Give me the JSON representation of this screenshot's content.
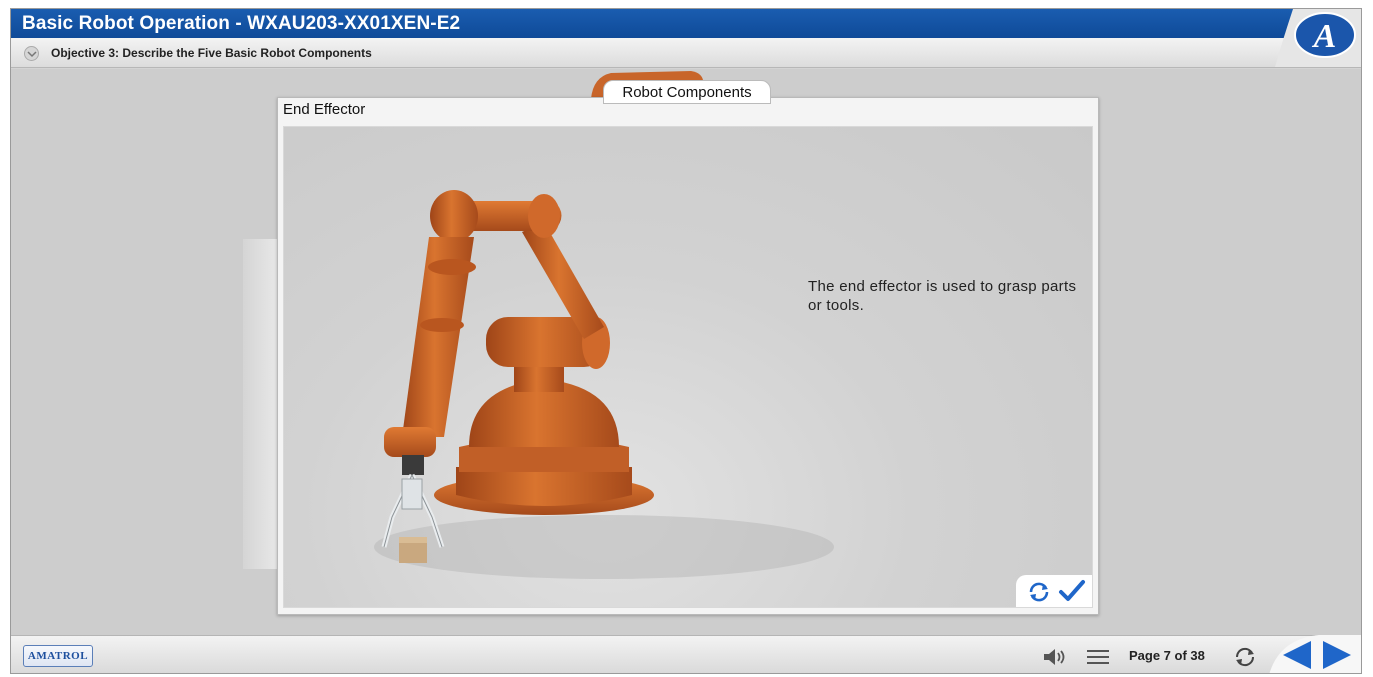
{
  "header": {
    "title": "Basic Robot Operation - WXAU203-XX01XEN-E2",
    "objective": "Objective 3: Describe the Five Basic Robot Components",
    "logo_letter": "A"
  },
  "stage": {
    "tab_label": "Robot Components"
  },
  "panel": {
    "title": "End Effector",
    "text": "The end effector is used to grasp parts or tools."
  },
  "footer": {
    "brand": "AMATROL",
    "page_indicator": "Page 7 of 38"
  },
  "colors": {
    "title_bar": "#1a5db0",
    "accent": "#1f66c9",
    "robot": "#c8652a"
  },
  "icons": {
    "objective_toggle": "chevron-down-icon",
    "replay": "replay-icon",
    "check": "check-icon",
    "sound": "speaker-icon",
    "menu": "menu-icon",
    "refresh": "refresh-icon",
    "prev": "prev-arrow-icon",
    "next": "next-arrow-icon"
  }
}
